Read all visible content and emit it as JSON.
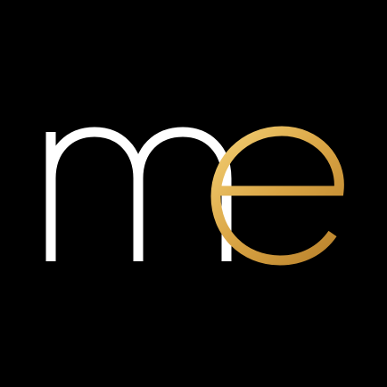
{
  "logo": {
    "text": "me",
    "letter_m": "m",
    "letter_e": "e",
    "colors": {
      "background": "#000000",
      "m": "#ffffff",
      "e_light": "#f3cf73",
      "e_mid": "#d9a444",
      "e_dark": "#b8812b"
    }
  }
}
